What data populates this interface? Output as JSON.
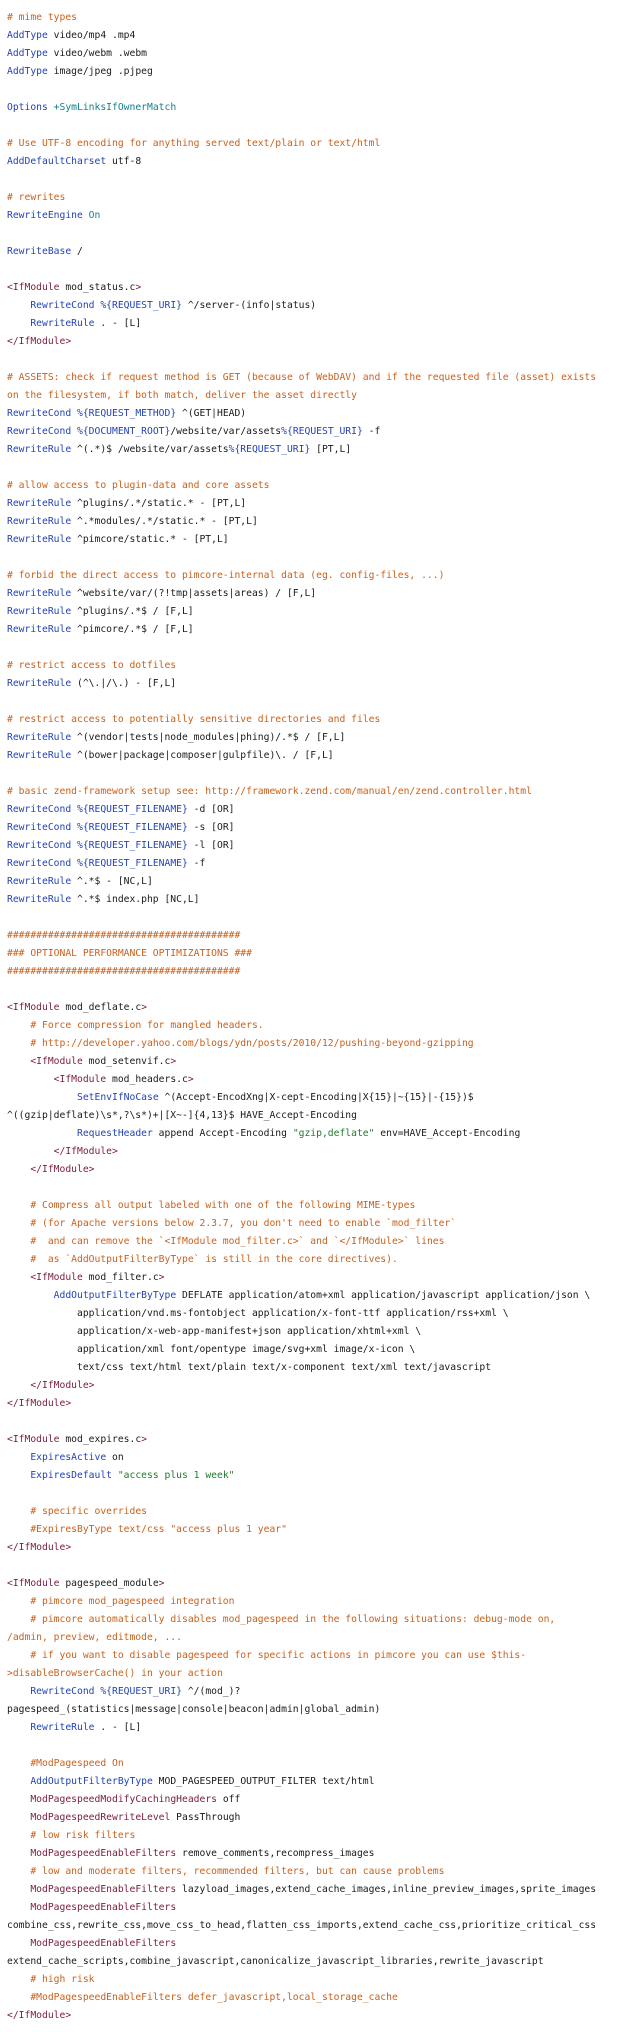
{
  "colors": {
    "comment": "#c8611c",
    "directive": "#2343b6",
    "tag": "#7a1c3c",
    "variable": "#2343b6",
    "string": "#1f7a2b",
    "option": "#12808a",
    "text": "#1a1a1a",
    "background": "#ffffff"
  },
  "lines": [
    [
      {
        "t": "comment",
        "v": "# mime types"
      }
    ],
    [
      {
        "t": "directive",
        "v": "AddType"
      },
      {
        "t": "text",
        "v": " video/mp4 .mp4"
      }
    ],
    [
      {
        "t": "directive",
        "v": "AddType"
      },
      {
        "t": "text",
        "v": " video/webm .webm"
      }
    ],
    [
      {
        "t": "directive",
        "v": "AddType"
      },
      {
        "t": "text",
        "v": " image/jpeg .pjpeg"
      }
    ],
    [],
    [
      {
        "t": "directive",
        "v": "Options"
      },
      {
        "t": "text",
        "v": " "
      },
      {
        "t": "option",
        "v": "+SymLinksIfOwnerMatch"
      }
    ],
    [],
    [
      {
        "t": "comment",
        "v": "# Use UTF-8 encoding for anything served text/plain or text/html"
      }
    ],
    [
      {
        "t": "directive",
        "v": "AddDefaultCharset"
      },
      {
        "t": "text",
        "v": " utf-8"
      }
    ],
    [],
    [
      {
        "t": "comment",
        "v": "# rewrites"
      }
    ],
    [
      {
        "t": "directive",
        "v": "RewriteEngine"
      },
      {
        "t": "text",
        "v": " "
      },
      {
        "t": "option",
        "v": "On"
      }
    ],
    [],
    [
      {
        "t": "directive",
        "v": "RewriteBase"
      },
      {
        "t": "text",
        "v": " /"
      }
    ],
    [],
    [
      {
        "t": "tag",
        "v": "<IfModule"
      },
      {
        "t": "text",
        "v": " mod_status.c"
      },
      {
        "t": "tag",
        "v": ">"
      }
    ],
    [
      {
        "t": "text",
        "v": "    "
      },
      {
        "t": "directive",
        "v": "RewriteCond"
      },
      {
        "t": "text",
        "v": " "
      },
      {
        "t": "variable",
        "v": "%{REQUEST_URI}"
      },
      {
        "t": "text",
        "v": " ^/server-(info|status)"
      }
    ],
    [
      {
        "t": "text",
        "v": "    "
      },
      {
        "t": "directive",
        "v": "RewriteRule"
      },
      {
        "t": "text",
        "v": " . - [L]"
      }
    ],
    [
      {
        "t": "tag",
        "v": "</IfModule>"
      }
    ],
    [],
    [
      {
        "t": "comment",
        "v": "# ASSETS: check if request method is GET (because of WebDAV) and if the requested file (asset) exists"
      }
    ],
    [
      {
        "t": "comment",
        "v": "on the filesystem, if both match, deliver the asset directly"
      }
    ],
    [
      {
        "t": "directive",
        "v": "RewriteCond"
      },
      {
        "t": "text",
        "v": " "
      },
      {
        "t": "variable",
        "v": "%{REQUEST_METHOD}"
      },
      {
        "t": "text",
        "v": " ^(GET|HEAD)"
      }
    ],
    [
      {
        "t": "directive",
        "v": "RewriteCond"
      },
      {
        "t": "text",
        "v": " "
      },
      {
        "t": "variable",
        "v": "%{DOCUMENT_ROOT}"
      },
      {
        "t": "text",
        "v": "/website/var/assets"
      },
      {
        "t": "variable",
        "v": "%{REQUEST_URI}"
      },
      {
        "t": "text",
        "v": " -f"
      }
    ],
    [
      {
        "t": "directive",
        "v": "RewriteRule"
      },
      {
        "t": "text",
        "v": " ^(.*)$ /website/var/assets"
      },
      {
        "t": "variable",
        "v": "%{REQUEST_URI}"
      },
      {
        "t": "text",
        "v": " [PT,L]"
      }
    ],
    [],
    [
      {
        "t": "comment",
        "v": "# allow access to plugin-data and core assets"
      }
    ],
    [
      {
        "t": "directive",
        "v": "RewriteRule"
      },
      {
        "t": "text",
        "v": " ^plugins/.*/static.* - [PT,L]"
      }
    ],
    [
      {
        "t": "directive",
        "v": "RewriteRule"
      },
      {
        "t": "text",
        "v": " ^.*modules/.*/static.* - [PT,L]"
      }
    ],
    [
      {
        "t": "directive",
        "v": "RewriteRule"
      },
      {
        "t": "text",
        "v": " ^pimcore/static.* - [PT,L]"
      }
    ],
    [],
    [
      {
        "t": "comment",
        "v": "# forbid the direct access to pimcore-internal data (eg. config-files, ...)"
      }
    ],
    [
      {
        "t": "directive",
        "v": "RewriteRule"
      },
      {
        "t": "text",
        "v": " ^website/var/(?!tmp|assets|areas) / [F,L]"
      }
    ],
    [
      {
        "t": "directive",
        "v": "RewriteRule"
      },
      {
        "t": "text",
        "v": " ^plugins/.*$ / [F,L]"
      }
    ],
    [
      {
        "t": "directive",
        "v": "RewriteRule"
      },
      {
        "t": "text",
        "v": " ^pimcore/.*$ / [F,L]"
      }
    ],
    [],
    [
      {
        "t": "comment",
        "v": "# restrict access to dotfiles"
      }
    ],
    [
      {
        "t": "directive",
        "v": "RewriteRule"
      },
      {
        "t": "text",
        "v": " (^\\.|/\\.) - [F,L]"
      }
    ],
    [],
    [
      {
        "t": "comment",
        "v": "# restrict access to potentially sensitive directories and files"
      }
    ],
    [
      {
        "t": "directive",
        "v": "RewriteRule"
      },
      {
        "t": "text",
        "v": " ^(vendor|tests|node_modules|phing)/.*$ / [F,L]"
      }
    ],
    [
      {
        "t": "directive",
        "v": "RewriteRule"
      },
      {
        "t": "text",
        "v": " ^(bower|package|composer|gulpfile)\\. / [F,L]"
      }
    ],
    [],
    [
      {
        "t": "comment",
        "v": "# basic zend-framework setup see: http://framework.zend.com/manual/en/zend.controller.html"
      }
    ],
    [
      {
        "t": "directive",
        "v": "RewriteCond"
      },
      {
        "t": "text",
        "v": " "
      },
      {
        "t": "variable",
        "v": "%{REQUEST_FILENAME}"
      },
      {
        "t": "text",
        "v": " -d [OR]"
      }
    ],
    [
      {
        "t": "directive",
        "v": "RewriteCond"
      },
      {
        "t": "text",
        "v": " "
      },
      {
        "t": "variable",
        "v": "%{REQUEST_FILENAME}"
      },
      {
        "t": "text",
        "v": " -s [OR]"
      }
    ],
    [
      {
        "t": "directive",
        "v": "RewriteCond"
      },
      {
        "t": "text",
        "v": " "
      },
      {
        "t": "variable",
        "v": "%{REQUEST_FILENAME}"
      },
      {
        "t": "text",
        "v": " -l [OR]"
      }
    ],
    [
      {
        "t": "directive",
        "v": "RewriteCond"
      },
      {
        "t": "text",
        "v": " "
      },
      {
        "t": "variable",
        "v": "%{REQUEST_FILENAME}"
      },
      {
        "t": "text",
        "v": " -f"
      }
    ],
    [
      {
        "t": "directive",
        "v": "RewriteRule"
      },
      {
        "t": "text",
        "v": " ^.*$ - [NC,L]"
      }
    ],
    [
      {
        "t": "directive",
        "v": "RewriteRule"
      },
      {
        "t": "text",
        "v": " ^.*$ index.php [NC,L]"
      }
    ],
    [],
    [
      {
        "t": "comment",
        "v": "########################################"
      }
    ],
    [
      {
        "t": "comment",
        "v": "### OPTIONAL PERFORMANCE OPTIMIZATIONS ###"
      }
    ],
    [
      {
        "t": "comment",
        "v": "########################################"
      }
    ],
    [],
    [
      {
        "t": "tag",
        "v": "<IfModule"
      },
      {
        "t": "text",
        "v": " mod_deflate.c"
      },
      {
        "t": "tag",
        "v": ">"
      }
    ],
    [
      {
        "t": "text",
        "v": "    "
      },
      {
        "t": "comment",
        "v": "# Force compression for mangled headers."
      }
    ],
    [
      {
        "t": "text",
        "v": "    "
      },
      {
        "t": "comment",
        "v": "# http://developer.yahoo.com/blogs/ydn/posts/2010/12/pushing-beyond-gzipping"
      }
    ],
    [
      {
        "t": "text",
        "v": "    "
      },
      {
        "t": "tag",
        "v": "<IfModule"
      },
      {
        "t": "text",
        "v": " mod_setenvif.c"
      },
      {
        "t": "tag",
        "v": ">"
      }
    ],
    [
      {
        "t": "text",
        "v": "        "
      },
      {
        "t": "tag",
        "v": "<IfModule"
      },
      {
        "t": "text",
        "v": " mod_headers.c"
      },
      {
        "t": "tag",
        "v": ">"
      }
    ],
    [
      {
        "t": "text",
        "v": "            "
      },
      {
        "t": "directive",
        "v": "SetEnvIfNoCase"
      },
      {
        "t": "text",
        "v": " ^(Accept-EncodXng|X-cept-Encoding|X{15}|~{15}|-{15})$"
      }
    ],
    [
      {
        "t": "text",
        "v": "^((gzip|deflate)\\s*,?\\s*)+|[X~-]{4,13}$ HAVE_Accept-Encoding"
      }
    ],
    [
      {
        "t": "text",
        "v": "            "
      },
      {
        "t": "directive",
        "v": "RequestHeader"
      },
      {
        "t": "text",
        "v": " append Accept-Encoding "
      },
      {
        "t": "string",
        "v": "\"gzip,deflate\""
      },
      {
        "t": "text",
        "v": " env=HAVE_Accept-Encoding"
      }
    ],
    [
      {
        "t": "text",
        "v": "        "
      },
      {
        "t": "tag",
        "v": "</IfModule>"
      }
    ],
    [
      {
        "t": "text",
        "v": "    "
      },
      {
        "t": "tag",
        "v": "</IfModule>"
      }
    ],
    [],
    [
      {
        "t": "text",
        "v": "    "
      },
      {
        "t": "comment",
        "v": "# Compress all output labeled with one of the following MIME-types"
      }
    ],
    [
      {
        "t": "text",
        "v": "    "
      },
      {
        "t": "comment",
        "v": "# (for Apache versions below 2.3.7, you don't need to enable `mod_filter`"
      }
    ],
    [
      {
        "t": "text",
        "v": "    "
      },
      {
        "t": "comment",
        "v": "#  and can remove the `<IfModule mod_filter.c>` and `</IfModule>` lines"
      }
    ],
    [
      {
        "t": "text",
        "v": "    "
      },
      {
        "t": "comment",
        "v": "#  as `AddOutputFilterByType` is still in the core directives)."
      }
    ],
    [
      {
        "t": "text",
        "v": "    "
      },
      {
        "t": "tag",
        "v": "<IfModule"
      },
      {
        "t": "text",
        "v": " mod_filter.c"
      },
      {
        "t": "tag",
        "v": ">"
      }
    ],
    [
      {
        "t": "text",
        "v": "        "
      },
      {
        "t": "directive",
        "v": "AddOutputFilterByType"
      },
      {
        "t": "text",
        "v": " DEFLATE application/atom+xml application/javascript application/json \\"
      }
    ],
    [
      {
        "t": "text",
        "v": "            application/vnd.ms-fontobject application/x-font-ttf application/rss+xml \\"
      }
    ],
    [
      {
        "t": "text",
        "v": "            application/x-web-app-manifest+json application/xhtml+xml \\"
      }
    ],
    [
      {
        "t": "text",
        "v": "            application/xml font/opentype image/svg+xml image/x-icon \\"
      }
    ],
    [
      {
        "t": "text",
        "v": "            text/css text/html text/plain text/x-component text/xml text/javascript"
      }
    ],
    [
      {
        "t": "text",
        "v": "    "
      },
      {
        "t": "tag",
        "v": "</IfModule>"
      }
    ],
    [
      {
        "t": "tag",
        "v": "</IfModule>"
      }
    ],
    [],
    [
      {
        "t": "tag",
        "v": "<IfModule"
      },
      {
        "t": "text",
        "v": " mod_expires.c"
      },
      {
        "t": "tag",
        "v": ">"
      }
    ],
    [
      {
        "t": "text",
        "v": "    "
      },
      {
        "t": "directive",
        "v": "ExpiresActive"
      },
      {
        "t": "text",
        "v": " on"
      }
    ],
    [
      {
        "t": "text",
        "v": "    "
      },
      {
        "t": "directive",
        "v": "ExpiresDefault"
      },
      {
        "t": "text",
        "v": " "
      },
      {
        "t": "string",
        "v": "\"access plus 1 week\""
      }
    ],
    [],
    [
      {
        "t": "text",
        "v": "    "
      },
      {
        "t": "comment",
        "v": "# specific overrides"
      }
    ],
    [
      {
        "t": "text",
        "v": "    "
      },
      {
        "t": "comment",
        "v": "#ExpiresByType text/css \"access plus 1 year\""
      }
    ],
    [
      {
        "t": "tag",
        "v": "</IfModule>"
      }
    ],
    [],
    [
      {
        "t": "tag",
        "v": "<IfModule"
      },
      {
        "t": "text",
        "v": " pagespeed_module"
      },
      {
        "t": "tag",
        "v": ">"
      }
    ],
    [
      {
        "t": "text",
        "v": "    "
      },
      {
        "t": "comment",
        "v": "# pimcore mod_pagespeed integration"
      }
    ],
    [
      {
        "t": "text",
        "v": "    "
      },
      {
        "t": "comment",
        "v": "# pimcore automatically disables mod_pagespeed in the following situations: debug-mode on,"
      }
    ],
    [
      {
        "t": "comment",
        "v": "/admin, preview, editmode, ..."
      }
    ],
    [
      {
        "t": "text",
        "v": "    "
      },
      {
        "t": "comment",
        "v": "# if you want to disable pagespeed for specific actions in pimcore you can use $this-"
      }
    ],
    [
      {
        "t": "comment",
        "v": ">disableBrowserCache() in your action"
      }
    ],
    [
      {
        "t": "text",
        "v": "    "
      },
      {
        "t": "directive",
        "v": "RewriteCond"
      },
      {
        "t": "text",
        "v": " "
      },
      {
        "t": "variable",
        "v": "%{REQUEST_URI}"
      },
      {
        "t": "text",
        "v": " ^/(mod_)?"
      }
    ],
    [
      {
        "t": "text",
        "v": "pagespeed_(statistics|message|console|beacon|admin|global_admin)"
      }
    ],
    [
      {
        "t": "text",
        "v": "    "
      },
      {
        "t": "directive",
        "v": "RewriteRule"
      },
      {
        "t": "text",
        "v": " . - [L]"
      }
    ],
    [],
    [
      {
        "t": "text",
        "v": "    "
      },
      {
        "t": "comment",
        "v": "#ModPagespeed On"
      }
    ],
    [
      {
        "t": "text",
        "v": "    "
      },
      {
        "t": "directive",
        "v": "AddOutputFilterByType"
      },
      {
        "t": "text",
        "v": " MOD_PAGESPEED_OUTPUT_FILTER text/html"
      }
    ],
    [
      {
        "t": "text",
        "v": "    "
      },
      {
        "t": "tag",
        "v": "ModPagespeedModifyCachingHeaders"
      },
      {
        "t": "text",
        "v": " off"
      }
    ],
    [
      {
        "t": "text",
        "v": "    "
      },
      {
        "t": "tag",
        "v": "ModPagespeedRewriteLevel"
      },
      {
        "t": "text",
        "v": " PassThrough"
      }
    ],
    [
      {
        "t": "text",
        "v": "    "
      },
      {
        "t": "comment",
        "v": "# low risk filters"
      }
    ],
    [
      {
        "t": "text",
        "v": "    "
      },
      {
        "t": "tag",
        "v": "ModPagespeedEnableFilters"
      },
      {
        "t": "text",
        "v": " remove_comments,recompress_images"
      }
    ],
    [
      {
        "t": "text",
        "v": "    "
      },
      {
        "t": "comment",
        "v": "# low and moderate filters, recommended filters, but can cause problems"
      }
    ],
    [
      {
        "t": "text",
        "v": "    "
      },
      {
        "t": "tag",
        "v": "ModPagespeedEnableFilters"
      },
      {
        "t": "text",
        "v": " lazyload_images,extend_cache_images,inline_preview_images,sprite_images"
      }
    ],
    [
      {
        "t": "text",
        "v": "    "
      },
      {
        "t": "tag",
        "v": "ModPagespeedEnableFilters"
      }
    ],
    [
      {
        "t": "text",
        "v": "combine_css,rewrite_css,move_css_to_head,flatten_css_imports,extend_cache_css,prioritize_critical_css"
      }
    ],
    [
      {
        "t": "text",
        "v": "    "
      },
      {
        "t": "tag",
        "v": "ModPagespeedEnableFilters"
      }
    ],
    [
      {
        "t": "text",
        "v": "extend_cache_scripts,combine_javascript,canonicalize_javascript_libraries,rewrite_javascript"
      }
    ],
    [
      {
        "t": "text",
        "v": "    "
      },
      {
        "t": "comment",
        "v": "# high risk"
      }
    ],
    [
      {
        "t": "text",
        "v": "    "
      },
      {
        "t": "comment",
        "v": "#ModPagespeedEnableFilters defer_javascript,local_storage_cache"
      }
    ],
    [
      {
        "t": "tag",
        "v": "</IfModule>"
      }
    ]
  ]
}
